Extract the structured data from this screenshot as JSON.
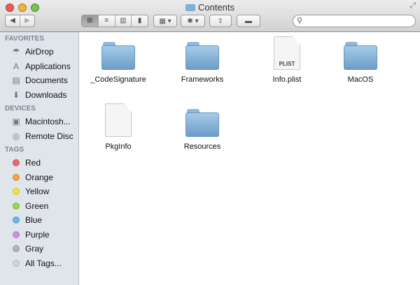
{
  "window": {
    "title": "Contents"
  },
  "toolbar": {
    "back": "◀",
    "forward": "▶",
    "views": [
      "⊞",
      "≡",
      "▥",
      "▮"
    ],
    "arrange": "▦ ▾",
    "action": "✱ ▾",
    "share": "⇪",
    "tags": "▬",
    "search_placeholder": ""
  },
  "sidebar": {
    "favorites_header": "FAVORITES",
    "favorites": [
      {
        "label": "AirDrop",
        "icon": "☂"
      },
      {
        "label": "Applications",
        "icon": "A"
      },
      {
        "label": "Documents",
        "icon": "▤"
      },
      {
        "label": "Downloads",
        "icon": "⬇"
      }
    ],
    "devices_header": "DEVICES",
    "devices": [
      {
        "label": "Macintosh...",
        "icon": "▣"
      },
      {
        "label": "Remote Disc",
        "icon": "◎"
      }
    ],
    "tags_header": "TAGS",
    "tags": [
      {
        "label": "Red",
        "color": "#f0646a"
      },
      {
        "label": "Orange",
        "color": "#f6a33c"
      },
      {
        "label": "Yellow",
        "color": "#f4e03c"
      },
      {
        "label": "Green",
        "color": "#9ad63c"
      },
      {
        "label": "Blue",
        "color": "#6cb6ec"
      },
      {
        "label": "Purple",
        "color": "#d88ae8"
      },
      {
        "label": "Gray",
        "color": "#b4b4b4"
      },
      {
        "label": "All Tags...",
        "color": "#d0d4da"
      }
    ]
  },
  "files": [
    {
      "name": "_CodeSignature",
      "type": "folder"
    },
    {
      "name": "Frameworks",
      "type": "folder"
    },
    {
      "name": "Info.plist",
      "type": "document",
      "badge": "PLIST"
    },
    {
      "name": "MacOS",
      "type": "folder"
    },
    {
      "name": "PkgInfo",
      "type": "document"
    },
    {
      "name": "Resources",
      "type": "folder"
    }
  ]
}
